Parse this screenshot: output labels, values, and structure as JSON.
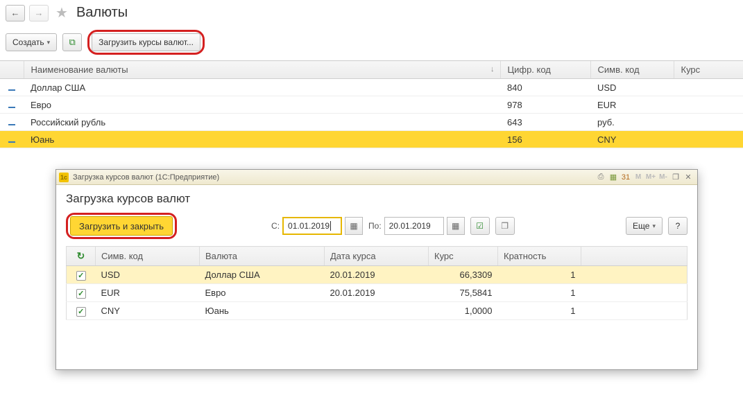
{
  "header": {
    "title": "Валюты"
  },
  "toolbar": {
    "create_label": "Создать",
    "download_rates_label": "Загрузить курсы валют..."
  },
  "grid": {
    "headers": {
      "name": "Наименование валюты",
      "num_code": "Цифр. код",
      "sym_code": "Симв. код",
      "rate": "Курс"
    },
    "rows": [
      {
        "name": "Доллар США",
        "num": "840",
        "sym": "USD",
        "rate": "",
        "selected": false
      },
      {
        "name": "Евро",
        "num": "978",
        "sym": "EUR",
        "rate": "",
        "selected": false
      },
      {
        "name": "Российский рубль",
        "num": "643",
        "sym": "руб.",
        "rate": "",
        "selected": false
      },
      {
        "name": "Юань",
        "num": "156",
        "sym": "CNY",
        "rate": "",
        "selected": true
      }
    ]
  },
  "modal": {
    "window_title": "Загрузка курсов валют  (1С:Предприятие)",
    "heading": "Загрузка курсов валют",
    "submit_label": "Загрузить и закрыть",
    "from_label": "С:",
    "to_label": "По:",
    "from_value": "01.01.2019",
    "to_value": "20.01.2019",
    "more_label": "Еще",
    "help_label": "?",
    "table": {
      "headers": {
        "check": "",
        "sym": "Симв. код",
        "currency": "Валюта",
        "date": "Дата курса",
        "rate": "Курс",
        "mult": "Кратность"
      },
      "rows": [
        {
          "checked": true,
          "sym": "USD",
          "currency": "Доллар США",
          "date": "20.01.2019",
          "rate": "66,3309",
          "mult": "1",
          "hl": true
        },
        {
          "checked": true,
          "sym": "EUR",
          "currency": "Евро",
          "date": "20.01.2019",
          "rate": "75,5841",
          "mult": "1",
          "hl": false
        },
        {
          "checked": true,
          "sym": "CNY",
          "currency": "Юань",
          "date": "",
          "rate": "1,0000",
          "mult": "1",
          "hl": false
        }
      ]
    }
  }
}
